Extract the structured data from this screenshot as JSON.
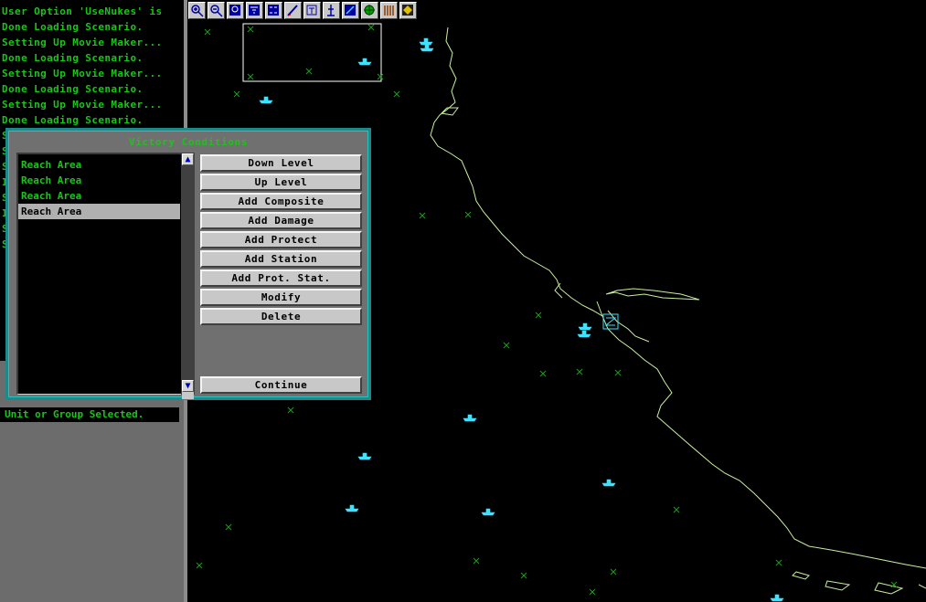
{
  "log": {
    "lines": [
      "User Option 'UseNukes' is",
      "Done Loading Scenario.",
      "Setting Up Movie Maker...",
      "Done Loading Scenario.",
      "Setting Up Movie Maker...",
      "Done Loading Scenario.",
      "Setting Up Movie Maker...",
      "Done Loading Scenario.",
      "S",
      "S",
      "S",
      "I",
      "S",
      "I",
      "S",
      "S"
    ]
  },
  "status": {
    "text": "Unit or Group Selected."
  },
  "toolbar": {
    "tools": [
      {
        "icon": "zoom-in-icon"
      },
      {
        "icon": "zoom-out-icon"
      },
      {
        "icon": "zoom-reset-icon"
      },
      {
        "icon": "filter-icon"
      },
      {
        "icon": "side-icon"
      },
      {
        "icon": "draw-icon"
      },
      {
        "icon": "text-icon"
      },
      {
        "icon": "range-icon"
      },
      {
        "icon": "plot-icon"
      },
      {
        "icon": "target-icon"
      },
      {
        "icon": "grid-icon"
      },
      {
        "icon": "scale-icon"
      },
      {
        "icon": "navigate-icon"
      }
    ],
    "colors": {
      "face": "#c8c8c8",
      "glyph": "#0000a0"
    }
  },
  "dialog": {
    "title": "Victory Conditions",
    "conditions": [
      "Reach Area",
      "Reach Area",
      "Reach Area",
      "Reach Area"
    ],
    "selected_index": 3,
    "buttons": {
      "down_level": "Down Level",
      "up_level": "Up Level",
      "add_composite": "Add Composite",
      "add_damage": "Add Damage",
      "add_protect": "Add Protect",
      "add_station": "Add Station",
      "add_prot_stat": "Add Prot. Stat.",
      "modify": "Modify",
      "delete": "Delete",
      "continue": "Continue"
    }
  },
  "colors": {
    "log_text": "#19c519",
    "dialog_border": "#1c8a8a",
    "coastline": "#c8f0a0",
    "ship": "#40e0ff",
    "marker": "#1a9e1a",
    "selection_box": "#ffffff"
  }
}
